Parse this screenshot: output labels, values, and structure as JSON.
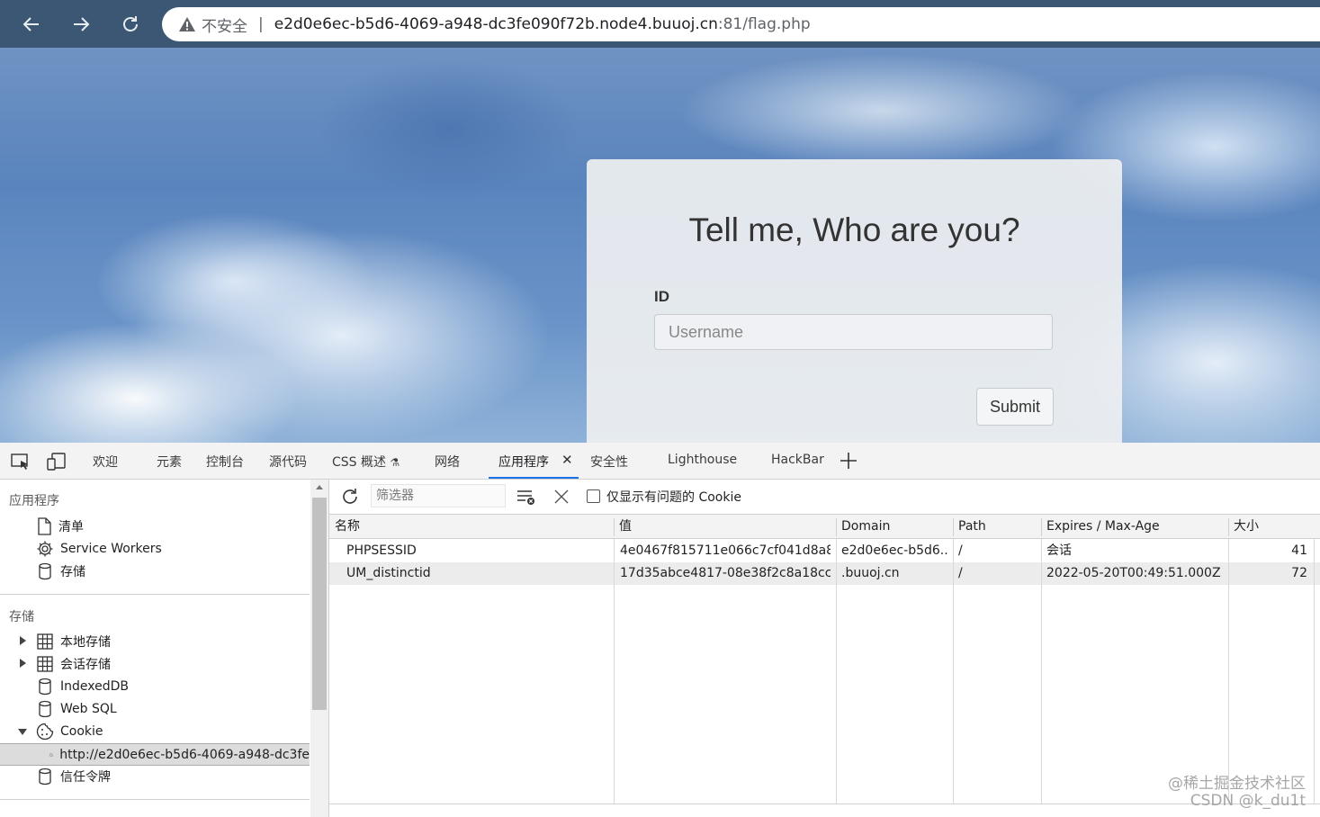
{
  "browser": {
    "security_label": "不安全",
    "url_host": "e2d0e6ec-b5d6-4069-a948-dc3fe090f72b.node4.buuoj.cn",
    "url_rest": ":81/flag.php"
  },
  "page": {
    "title": "Tell me, Who are you?",
    "id_label": "ID",
    "username_placeholder": "Username",
    "submit_label": "Submit"
  },
  "devtools": {
    "tabs": [
      "欢迎",
      "元素",
      "控制台",
      "源代码",
      "CSS 概述",
      "网络",
      "应用程序",
      "安全性",
      "Lighthouse",
      "HackBar"
    ],
    "active_tab": "应用程序",
    "sidebar": {
      "application_title": "应用程序",
      "application_items": [
        "清单",
        "Service Workers",
        "存储"
      ],
      "storage_title": "存储",
      "storage_items": [
        "本地存储",
        "会话存储",
        "IndexedDB",
        "Web SQL",
        "Cookie"
      ],
      "cookie_origin": "http://e2d0e6ec-b5d6-4069-a948-dc3fe",
      "trust_tokens": "信任令牌"
    },
    "cookies": {
      "filter_placeholder": "筛选器",
      "issues_only_label": "仅显示有问题的 Cookie",
      "columns": [
        "名称",
        "值",
        "Domain",
        "Path",
        "Expires / Max-Age",
        "大小"
      ],
      "rows": [
        {
          "name": "PHPSESSID",
          "value": "4e0467f815711e066c7cf041d8a8...",
          "domain": "e2d0e6ec-b5d6...",
          "path": "/",
          "expires": "会话",
          "size": "41"
        },
        {
          "name": "UM_distinctid",
          "value": "17d35abce4817-08e38f2c8a18cc-...",
          "domain": ".buuoj.cn",
          "path": "/",
          "expires": "2022-05-20T00:49:51.000Z",
          "size": "72"
        }
      ]
    }
  },
  "watermark": {
    "line1": "@稀土掘金技术社区",
    "line2": "CSDN @k_du1t"
  }
}
